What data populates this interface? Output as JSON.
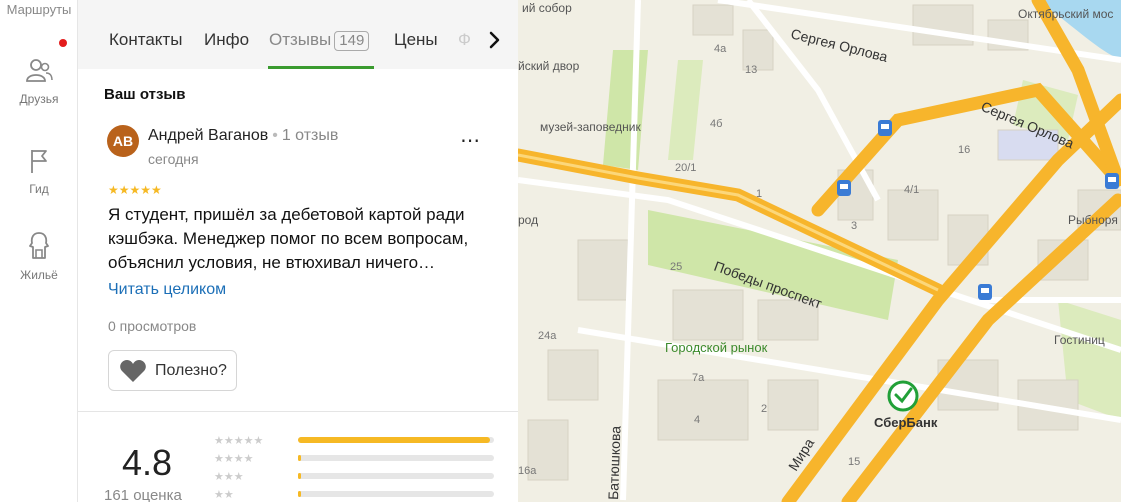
{
  "rail": {
    "top_label": "Маршруты",
    "items": [
      {
        "label": "Друзья",
        "icon": "friends-icon"
      },
      {
        "label": "Гид",
        "icon": "flag-icon"
      },
      {
        "label": "Жильё",
        "icon": "housing-icon"
      }
    ]
  },
  "tabs": {
    "items": [
      "Контакты",
      "Инфо",
      "Отзывы",
      "Цены"
    ],
    "reviews_count": "149",
    "faded": "Ф"
  },
  "review": {
    "section_title": "Ваш отзыв",
    "avatar_initials": "АВ",
    "author": "Андрей Ваганов",
    "author_reviews": "1 отзыв",
    "date": "сегодня",
    "stars": "★★★★★",
    "text": "Я студент, пришёл за дебетовой картой ради кэшбэка. Менеджер помог по всем вопросам, объяснил условия, не втюхивал ничего…",
    "read_more": "Читать целиком",
    "views": "0 просмотров",
    "useful": "Полезно?",
    "more": "⋯"
  },
  "rating": {
    "value": "4.8",
    "count": "161 оценка",
    "histogram": [
      {
        "stars": "★★★★★",
        "fraction": 0.98
      },
      {
        "stars": "★★★★",
        "fraction": 0.015
      },
      {
        "stars": "★★★",
        "fraction": 0.012
      },
      {
        "stars": "★★",
        "fraction": 0.01
      }
    ]
  },
  "map": {
    "labels": {
      "sobor": "ий собор",
      "dvor": "йский двор",
      "museum": "музей-заповедник",
      "gorod": "род",
      "market": "Городской рынок",
      "sberbank": "СберБанк",
      "oktyabrsky": "Октябрьский мос",
      "rybnoryad": "Рыбноря",
      "gostinitsa": "Гостиниц"
    },
    "streets": {
      "orlova_top": "Сергея Орлова",
      "orlova_right": "Сергея Орлова",
      "pobedy": "Победы проспект",
      "mira": "Мира",
      "batyushkova": "Батюшкова"
    },
    "house_numbers": [
      "4а",
      "13",
      "4б",
      "20/1",
      "1",
      "16",
      "4/1",
      "3",
      "25",
      "24а",
      "7а",
      "2",
      "4",
      "15",
      "16а"
    ]
  },
  "colors": {
    "accent_green": "#3a9b2f",
    "star_yellow": "#f6b924",
    "link_blue": "#1c6fb7",
    "avatar": "#b9621b",
    "road_orange": "#f7b52c"
  }
}
